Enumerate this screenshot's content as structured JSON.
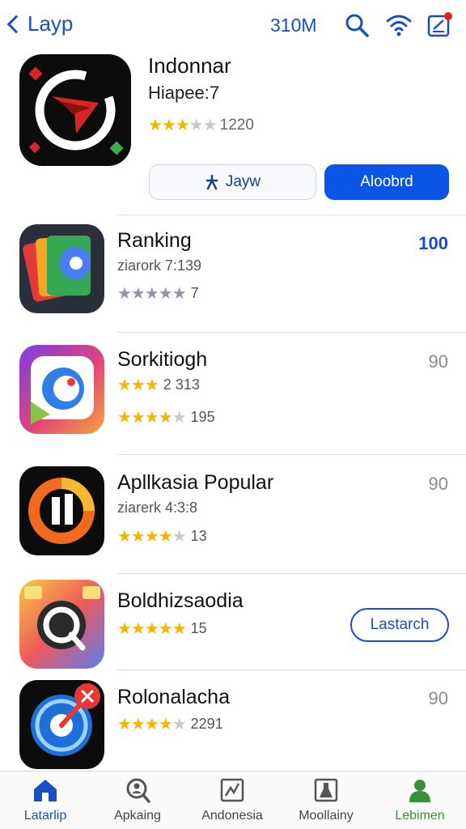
{
  "header": {
    "back_label": "Layp",
    "status_text": "310M",
    "icons": [
      "search-icon",
      "wifi-icon",
      "notification-edit-icon"
    ],
    "accent_color": "#1a4fc4"
  },
  "featured": {
    "title": "Indonnar",
    "subtitle": "Hiapee:7",
    "rating_count": "1220",
    "rating_stars": 3,
    "secondary_button": "Jayw",
    "primary_button": "Aloobrd"
  },
  "apps": [
    {
      "title": "Ranking",
      "line1": "ziarork 7:139",
      "line2_text": "7",
      "stars": 5,
      "value": "100",
      "value_color": "blue"
    },
    {
      "title": "Sorkitiogh",
      "line1_stars": 3,
      "line1_text": "2 313",
      "line2_text": "195",
      "stars": 4.5,
      "value": "90"
    },
    {
      "title": "Apllkasia Popular",
      "line1": "ziarerk 4:3:8",
      "line2_text": "13",
      "stars": 4.5,
      "value": "90"
    },
    {
      "title": "Boldhizsaodia",
      "line2_text": "15",
      "stars": 5,
      "button": "Lastarch"
    },
    {
      "title": "Rolonalacha",
      "line2_text": "2291",
      "stars": 4.5,
      "value": "90"
    }
  ],
  "tabs": [
    {
      "label": "Latarlip",
      "icon": "home-icon",
      "active": true
    },
    {
      "label": "Apkaing",
      "icon": "search-person-icon",
      "active": false
    },
    {
      "label": "Andonesia",
      "icon": "chart-icon",
      "active": false
    },
    {
      "label": "Moollainy",
      "icon": "flask-icon",
      "active": false
    },
    {
      "label": "Lebimen",
      "icon": "profile-icon",
      "active": false
    }
  ]
}
